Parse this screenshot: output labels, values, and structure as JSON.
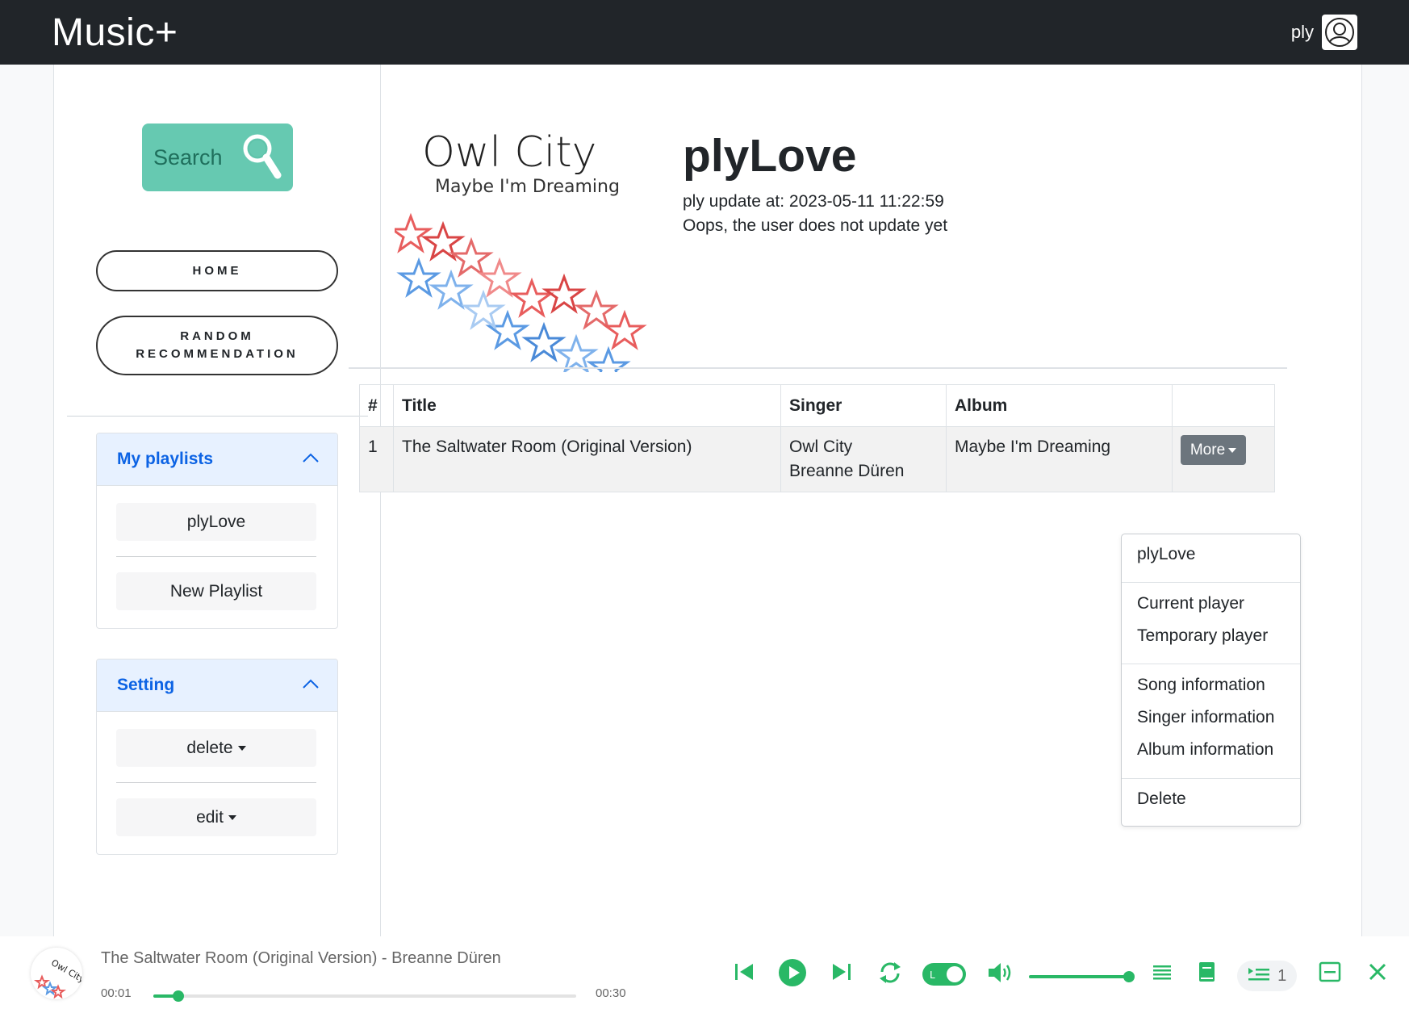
{
  "app": {
    "brand": "Music+",
    "user_name": "ply"
  },
  "sidebar": {
    "search_label": "Search",
    "home_label": "HOME",
    "random_label": "RANDOM RECOMMENDATION",
    "playlists": {
      "title": "My playlists",
      "items": [
        "plyLove",
        "New Playlist"
      ]
    },
    "setting": {
      "title": "Setting",
      "items": [
        "delete",
        "edit"
      ]
    }
  },
  "playlist": {
    "title": "plyLove",
    "updated": "ply update at: 2023-05-11 11:22:59",
    "description": "Oops, the user does not update yet",
    "cover": {
      "artist_text": "Owl City",
      "album_text": "Maybe I'm Dreaming"
    }
  },
  "table": {
    "columns": [
      "#",
      "Title",
      "Singer",
      "Album",
      ""
    ],
    "rows": [
      {
        "index": "1",
        "title": "The Saltwater Room (Original Version)",
        "singer_1": "Owl City",
        "singer_2": "Breanne Düren",
        "album": "Maybe I'm Dreaming",
        "action": "More"
      }
    ]
  },
  "dropdown": {
    "items": [
      "plyLove",
      "Current player",
      "Temporary player",
      "Song information",
      "Singer information",
      "Album information",
      "Delete"
    ]
  },
  "player": {
    "now_playing": "The Saltwater Room (Original Version) - Breanne Düren",
    "time_current": "00:01",
    "time_total": "00:30",
    "progress": 0.06,
    "volume": 1.0,
    "loop_toggle_label": "L",
    "queue_count": "1",
    "accent_color": "#29b866"
  },
  "colors": {
    "navbar": "#212529",
    "search_button": "#66c9b1",
    "accordion_header": "#e7f1ff",
    "accordion_title": "#0c63e4",
    "more_button": "#6c757d"
  }
}
